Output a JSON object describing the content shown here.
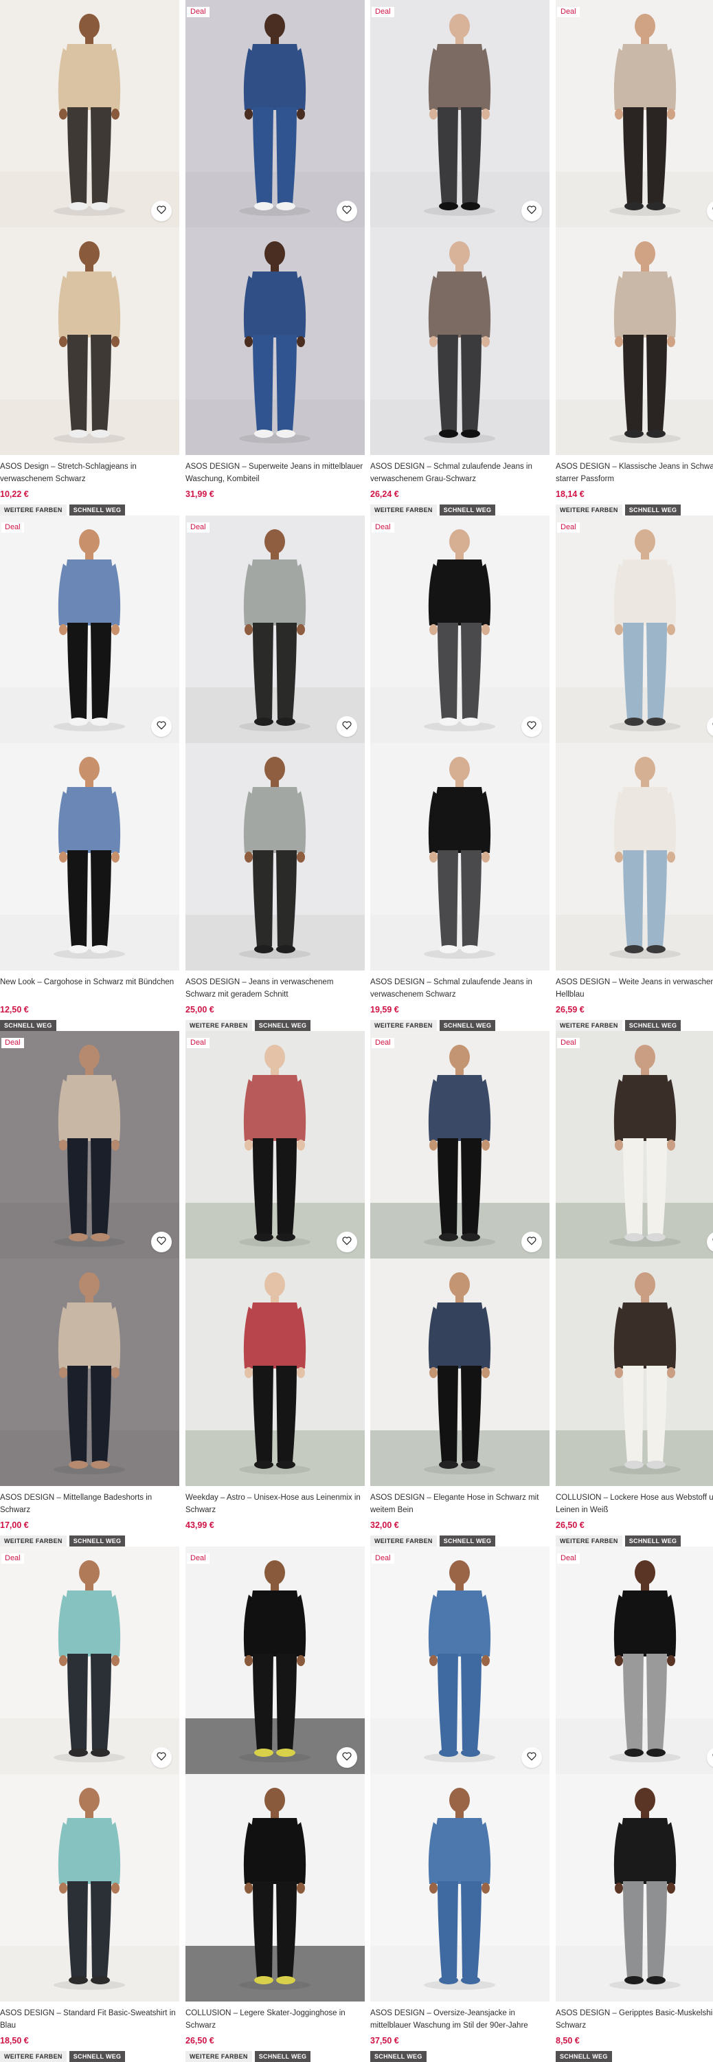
{
  "ui": {
    "heart_icon": "heart-icon",
    "colors": {
      "accent_price": "#d01345",
      "deal_text": "#d01345",
      "badge_fast_bg": "#525050",
      "badge_colors_bg": "#eeeeee"
    }
  },
  "products": [
    {
      "deal": "",
      "title": "ASOS Design – Stretch-Schlagjeans in verwaschenem Schwarz",
      "price": "10,22 €",
      "badges": [
        "WEITERE FARBEN",
        "SCHNELL WEG"
      ],
      "bg": "#f1ede8",
      "floor": "#e9e4dd",
      "top": "#d9c3a3",
      "bottom": "#3f3935",
      "shoe": "#eeeeee",
      "skin": "#8a5a3c",
      "back_top": "#d9c3a3",
      "back_bottom": "#3f3935"
    },
    {
      "deal": "Deal",
      "title": "ASOS DESIGN – Superweite Jeans in mittelblauer Waschung, Kombiteil",
      "price": "31,99 €",
      "badges": [],
      "bg": "#cfcdd3",
      "floor": "#c4c2c8",
      "top": "#2f4f86",
      "bottom": "#30548f",
      "shoe": "#f2f2f2",
      "skin": "#4a2e22",
      "back_top": "#2f4f86",
      "back_bottom": "#30548f"
    },
    {
      "deal": "Deal",
      "title": "ASOS DESIGN – Schmal zulaufende Jeans in verwaschenem Grau-Schwarz",
      "price": "26,24 €",
      "badges": [
        "WEITERE FARBEN",
        "SCHNELL WEG"
      ],
      "bg": "#e7e6e9",
      "floor": "#dcdbdf",
      "top": "#7b6b62",
      "bottom": "#3b3b3d",
      "shoe": "#111111",
      "skin": "#d8b39a",
      "back_top": "#7b6b62",
      "back_bottom": "#3b3b3d"
    },
    {
      "deal": "Deal",
      "title": "ASOS DESIGN – Klassische Jeans in Schwarz in starrer Passform",
      "price": "18,14 €",
      "badges": [
        "WEITERE FARBEN",
        "SCHNELL WEG"
      ],
      "bg": "#f2f1ef",
      "floor": "#e8e6e2",
      "top": "#c9b8a8",
      "bottom": "#2a2422",
      "shoe": "#2a2a2a",
      "skin": "#d1a385",
      "back_top": "#c9b8a8",
      "back_bottom": "#2a2422"
    },
    {
      "deal": "Deal",
      "title": "New Look – Cargohose in Schwarz mit Bündchen",
      "price": "12,50 €",
      "badges": [
        "SCHNELL WEG"
      ],
      "bg": "#f4f4f4",
      "floor": "#ebebeb",
      "top": "#6b87b5",
      "bottom": "#141414",
      "shoe": "#f4f4f4",
      "skin": "#c9916b",
      "back_top": "#6b87b5",
      "back_bottom": "#141414"
    },
    {
      "deal": "Deal",
      "title": "ASOS DESIGN – Jeans in verwaschenem Schwarz mit geradem Schnitt",
      "price": "25,00 €",
      "badges": [
        "WEITERE FARBEN",
        "SCHNELL WEG"
      ],
      "bg": "#e9e8eb",
      "floor": "#d7d5d5",
      "top": "#a3a7a4",
      "bottom": "#2a2a28",
      "shoe": "#1f1f1f",
      "skin": "#8f5d40",
      "back_top": "#a3a7a4",
      "back_bottom": "#2a2a28"
    },
    {
      "deal": "Deal",
      "title": "ASOS DESIGN – Schmal zulaufende Jeans in verwaschenem Schwarz",
      "price": "19,59 €",
      "badges": [
        "WEITERE FARBEN",
        "SCHNELL WEG"
      ],
      "bg": "#f3f3f3",
      "floor": "#ebebeb",
      "top": "#141414",
      "bottom": "#4a4a4d",
      "shoe": "#f5f5f5",
      "skin": "#d6ae92",
      "back_top": "#141414",
      "back_bottom": "#4a4a4d"
    },
    {
      "deal": "Deal",
      "title": "ASOS DESIGN – Weite Jeans in verwaschenem Hellblau",
      "price": "26,59 €",
      "badges": [
        "WEITERE FARBEN",
        "SCHNELL WEG"
      ],
      "bg": "#f1f0ee",
      "floor": "#e7e5e1",
      "top": "#ece8e1",
      "bottom": "#9cb5c8",
      "shoe": "#3a3a3a",
      "skin": "#d6b093",
      "back_top": "#ece8e1",
      "back_bottom": "#9cb5c8"
    },
    {
      "deal": "Deal",
      "title": "ASOS DESIGN – Mittellange Badeshorts in Schwarz",
      "price": "17,00 €",
      "badges": [
        "WEITERE FARBEN",
        "SCHNELL WEG"
      ],
      "bg": "#8a8587",
      "floor": "#807b7d",
      "top": "#c8b7a4",
      "bottom": "#1b1f29",
      "shoe": "#b58a6f",
      "skin": "#b58a6f",
      "back_top": "#c8b7a4",
      "back_bottom": "#1b1f29"
    },
    {
      "deal": "Deal",
      "title": "Weekday – Astro – Unisex-Hose aus Leinenmix in Schwarz",
      "price": "43,99 €",
      "badges": [],
      "bg": "#e8e8e6",
      "floor": "#a8b3a3",
      "top": "#b85a5a",
      "bottom": "#151515",
      "shoe": "#1a1a1a",
      "skin": "#e3c2a8",
      "back_top": "#b8454c",
      "back_bottom": "#151515"
    },
    {
      "deal": "Deal",
      "title": "ASOS DESIGN – Elegante Hose in Schwarz mit weitem Bein",
      "price": "32,00 €",
      "badges": [
        "WEITERE FARBEN",
        "SCHNELL WEG"
      ],
      "bg": "#f0efed",
      "floor": "#9fa99c",
      "top": "#3a4a66",
      "bottom": "#121212",
      "shoe": "#222222",
      "skin": "#c49572",
      "back_top": "#34425c",
      "back_bottom": "#121212"
    },
    {
      "deal": "Deal",
      "title": "COLLUSION – Lockere Hose aus Webstoff und Leinen in Weiß",
      "price": "26,50 €",
      "badges": [
        "WEITERE FARBEN",
        "SCHNELL WEG"
      ],
      "bg": "#e6e6e3",
      "floor": "#a5b0a1",
      "top": "#3a2e29",
      "bottom": "#f3f1ec",
      "shoe": "#d9d9d9",
      "skin": "#c99e82",
      "back_top": "#3a2e29",
      "back_bottom": "#f3f1ec"
    },
    {
      "deal": "Deal",
      "title": "ASOS DESIGN – Standard Fit Basic-Sweatshirt in Blau",
      "price": "18,50 €",
      "badges": [
        "WEITERE FARBEN",
        "SCHNELL WEG"
      ],
      "bg": "#f5f4f2",
      "floor": "#ebe9e5",
      "top": "#86c2c0",
      "bottom": "#2b2f36",
      "shoe": "#2b2b2b",
      "skin": "#b07a58",
      "back_top": "#86c2c0",
      "back_bottom": "#2b2f36"
    },
    {
      "deal": "Deal",
      "title": "COLLUSION – Legere Skater-Jogginghose in Schwarz",
      "price": "26,50 €",
      "badges": [
        "WEITERE FARBEN",
        "SCHNELL WEG"
      ],
      "bg": "#f3f3f3",
      "floor": "#1a1a1a",
      "top": "#111111",
      "bottom": "#151515",
      "shoe": "#d8d04a",
      "skin": "#8a5a3c",
      "back_top": "#111111",
      "back_bottom": "#151515"
    },
    {
      "deal": "Deal",
      "title": "ASOS DESIGN – Oversize-Jeansjacke in mittelblauer Waschung im Stil der 90er-Jahre",
      "price": "37,50 €",
      "badges": [
        "SCHNELL WEG"
      ],
      "bg": "#f6f6f6",
      "floor": "#eeeeee",
      "top": "#4d78ad",
      "bottom": "#3f6aa1",
      "shoe": "#3f6aa1",
      "skin": "#9a6546",
      "back_top": "#4d78ad",
      "back_bottom": "#3f6aa1"
    },
    {
      "deal": "Deal",
      "title": "ASOS DESIGN – Geripptes Basic-Muskelshirt in Schwarz",
      "price": "8,50 €",
      "badges": [
        "SCHNELL WEG"
      ],
      "bg": "#f5f5f5",
      "floor": "#ebebeb",
      "top": "#121212",
      "bottom": "#9a9a9a",
      "shoe": "#1d1d1d",
      "skin": "#5a3424",
      "back_top": "#1a1a1a",
      "back_bottom": "#8f9092"
    }
  ]
}
